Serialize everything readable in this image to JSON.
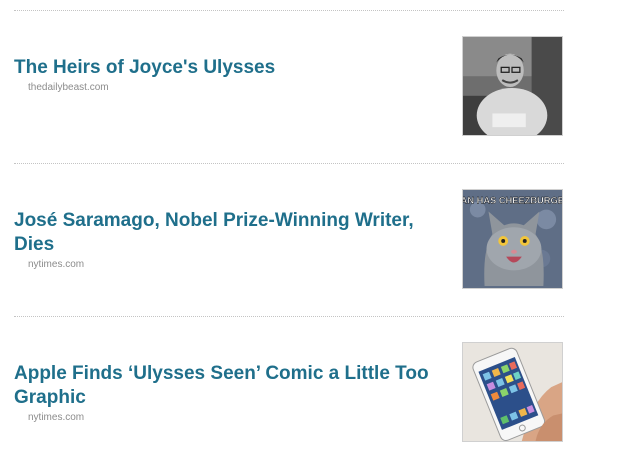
{
  "articles": [
    {
      "title": "The Heirs of Joyce's Ulysses",
      "source": "thedailybeast.com",
      "thumbnail_icon": "portrait-photo-icon"
    },
    {
      "title": "José Saramago, Nobel Prize-Winning Writer, Dies",
      "source": "nytimes.com",
      "thumbnail_icon": "lolcat-photo-icon",
      "thumbnail_caption": "I CAN HAS CHEEZBURGER?"
    },
    {
      "title": "Apple Finds ‘Ulysses Seen’ Comic a Little Too Graphic",
      "source": "nytimes.com",
      "thumbnail_icon": "smartphone-photo-icon"
    }
  ],
  "colors": {
    "headline": "#1f6f8b",
    "source": "#8c8c8c",
    "divider": "#c4c4c4"
  }
}
